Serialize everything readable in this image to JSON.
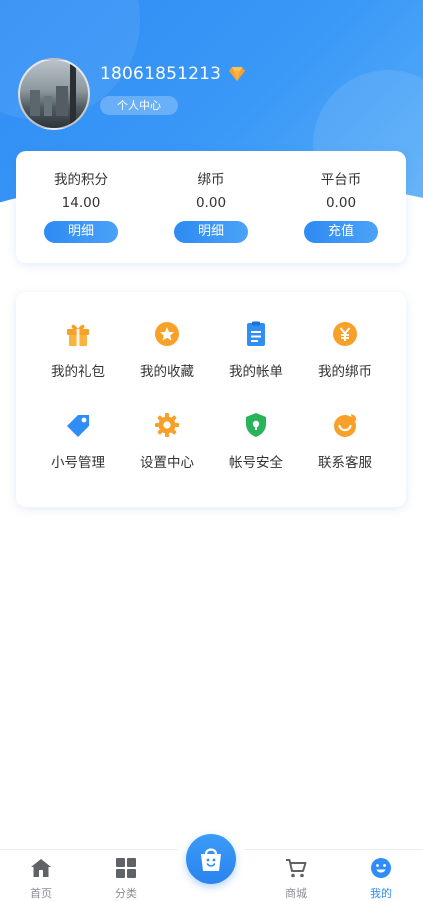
{
  "profile": {
    "phone": "18061851213",
    "center_label": "个人中心"
  },
  "stats": [
    {
      "label": "我的积分",
      "value": "14.00",
      "button": "明细"
    },
    {
      "label": "绑币",
      "value": "0.00",
      "button": "明细"
    },
    {
      "label": "平台币",
      "value": "0.00",
      "button": "充值"
    }
  ],
  "menu": [
    {
      "label": "我的礼包",
      "icon": "gift-icon",
      "color": "#f7a12b"
    },
    {
      "label": "我的收藏",
      "icon": "star-icon",
      "color": "#f7a12b"
    },
    {
      "label": "我的帐单",
      "icon": "bill-icon",
      "color": "#2f8df5"
    },
    {
      "label": "我的绑币",
      "icon": "yen-coin-icon",
      "color": "#f7a12b"
    },
    {
      "label": "小号管理",
      "icon": "tag-icon",
      "color": "#2f8df5"
    },
    {
      "label": "设置中心",
      "icon": "gear-icon",
      "color": "#f7a12b"
    },
    {
      "label": "帐号安全",
      "icon": "shield-icon",
      "color": "#29b35a"
    },
    {
      "label": "联系客服",
      "icon": "service-icon",
      "color": "#f7a12b"
    }
  ],
  "tabbar": {
    "items": [
      {
        "label": "首页",
        "icon": "home-icon"
      },
      {
        "label": "分类",
        "icon": "category-icon"
      },
      {
        "label": "商城",
        "icon": "cart-icon"
      },
      {
        "label": "我的",
        "icon": "smiley-icon"
      }
    ],
    "active": "我的",
    "center_icon": "shopping-bag-icon"
  },
  "colors": {
    "accent": "#2f8df5",
    "orange": "#f7a12b",
    "green": "#29b35a",
    "inactive": "#8a8f94"
  }
}
